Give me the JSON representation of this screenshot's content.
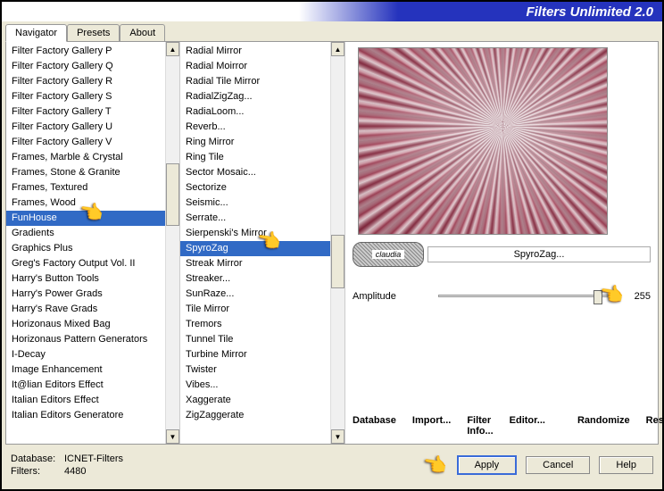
{
  "title": "Filters Unlimited 2.0",
  "tabs": [
    "Navigator",
    "Presets",
    "About"
  ],
  "active_tab": 0,
  "categories": [
    "Filter Factory Gallery P",
    "Filter Factory Gallery Q",
    "Filter Factory Gallery R",
    "Filter Factory Gallery S",
    "Filter Factory Gallery T",
    "Filter Factory Gallery U",
    "Filter Factory Gallery V",
    "Frames, Marble & Crystal",
    "Frames, Stone & Granite",
    "Frames, Textured",
    "Frames, Wood",
    "FunHouse",
    "Gradients",
    "Graphics Plus",
    "Greg's Factory Output Vol. II",
    "Harry's Button Tools",
    "Harry's Power Grads",
    "Harry's Rave Grads",
    "Horizonaus Mixed Bag",
    "Horizonaus Pattern Generators",
    "I-Decay",
    "Image Enhancement",
    "It@lian Editors Effect",
    "Italian Editors Effect",
    "Italian Editors Generatore"
  ],
  "filters": [
    "Radial Mirror",
    "Radial Moirror",
    "Radial Tile Mirror",
    "RadialZigZag...",
    "RadiaLoom...",
    "Reverb...",
    "Ring Mirror",
    "Ring Tile",
    "Sector Mosaic...",
    "Sectorize",
    "Seismic...",
    "Serrate...",
    "Sierpenski's Mirror",
    "SpyroZag",
    "Streak Mirror",
    "Streaker...",
    "SunRaze...",
    "Tile Mirror",
    "Tremors",
    "Tunnel Tile",
    "Turbine Mirror",
    "Twister",
    "Vibes...",
    "Xaggerate",
    "ZigZaggerate"
  ],
  "selected_category": 11,
  "selected_filter": 13,
  "current_filter_name": "SpyroZag...",
  "watermark_text": "claudia",
  "params": [
    {
      "name": "Amplitude",
      "value": 255
    }
  ],
  "buttons_left": [
    "Database",
    "Import...",
    "Filter Info...",
    "Editor..."
  ],
  "buttons_right": [
    "Randomize",
    "Reset"
  ],
  "bottom_buttons": [
    "Apply",
    "Cancel",
    "Help"
  ],
  "status": {
    "database_label": "Database:",
    "database_value": "ICNET-Filters",
    "filters_label": "Filters:",
    "filters_value": "4480"
  }
}
